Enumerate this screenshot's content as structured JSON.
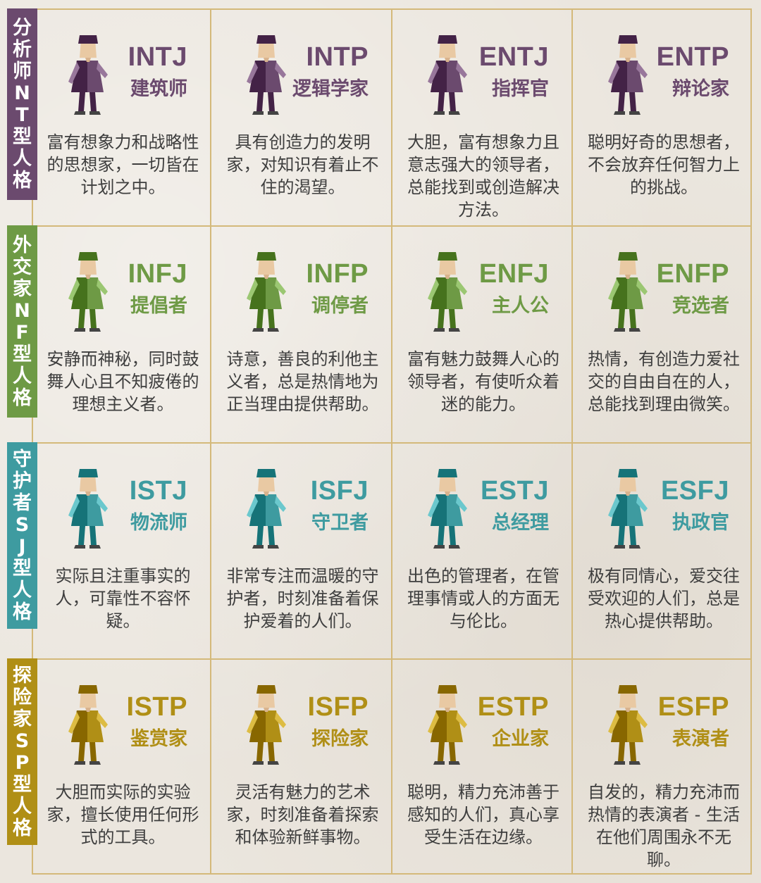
{
  "colors": {
    "NT": "#6b4a6e",
    "NF": "#6e9a45",
    "SJ": "#3e9ba0",
    "SP": "#b08f16",
    "grid_line": "#d4b97a"
  },
  "groups": [
    {
      "key": "NT",
      "label": [
        "分",
        "析",
        "师",
        "N",
        "T",
        "型",
        "人",
        "格"
      ],
      "types": [
        {
          "code": "INTJ",
          "name": "建筑师",
          "desc": "富有想象力和战略性的思想家，一切皆在计划之中。",
          "icon": "architect-figure-icon"
        },
        {
          "code": "INTP",
          "name": "逻辑学家",
          "desc": "具有创造力的发明家，对知识有着止不住的渴望。",
          "icon": "logician-figure-icon"
        },
        {
          "code": "ENTJ",
          "name": "指挥官",
          "desc": "大胆，富有想象力且意志强大的领导者，总能找到或创造解决方法。",
          "icon": "commander-figure-icon"
        },
        {
          "code": "ENTP",
          "name": "辩论家",
          "desc": "聪明好奇的思想者，不会放弃任何智力上的挑战。",
          "icon": "debater-figure-icon"
        }
      ]
    },
    {
      "key": "NF",
      "label": [
        "外",
        "交",
        "家",
        "N",
        "F",
        "型",
        "人",
        "格"
      ],
      "types": [
        {
          "code": "INFJ",
          "name": "提倡者",
          "desc": "安静而神秘，同时鼓舞人心且不知疲倦的理想主义者。",
          "icon": "advocate-figure-icon"
        },
        {
          "code": "INFP",
          "name": "调停者",
          "desc": "诗意，善良的利他主义者，总是热情地为正当理由提供帮助。",
          "icon": "mediator-figure-icon"
        },
        {
          "code": "ENFJ",
          "name": "主人公",
          "desc": "富有魅力鼓舞人心的领导者，有使听众着迷的能力。",
          "icon": "protagonist-figure-icon"
        },
        {
          "code": "ENFP",
          "name": "竞选者",
          "desc": "热情，有创造力爱社交的自由自在的人，总能找到理由微笑。",
          "icon": "campaigner-figure-icon"
        }
      ]
    },
    {
      "key": "SJ",
      "label": [
        "守",
        "护",
        "者",
        "S",
        "J",
        "型",
        "人",
        "格"
      ],
      "types": [
        {
          "code": "ISTJ",
          "name": "物流师",
          "desc": "实际且注重事实的人，可靠性不容怀疑。",
          "icon": "logistician-figure-icon"
        },
        {
          "code": "ISFJ",
          "name": "守卫者",
          "desc": "非常专注而温暖的守护者，时刻准备着保护爱着的人们。",
          "icon": "defender-figure-icon"
        },
        {
          "code": "ESTJ",
          "name": "总经理",
          "desc": "出色的管理者，在管理事情或人的方面无与伦比。",
          "icon": "executive-figure-icon"
        },
        {
          "code": "ESFJ",
          "name": "执政官",
          "desc": "极有同情心，爱交往受欢迎的人们，总是热心提供帮助。",
          "icon": "consul-figure-icon"
        }
      ]
    },
    {
      "key": "SP",
      "label": [
        "探",
        "险",
        "家",
        "S",
        "P",
        "型",
        "人",
        "格"
      ],
      "types": [
        {
          "code": "ISTP",
          "name": "鉴赏家",
          "desc": "大胆而实际的实验家，擅长使用任何形式的工具。",
          "icon": "virtuoso-figure-icon"
        },
        {
          "code": "ISFP",
          "name": "探险家",
          "desc": "灵活有魅力的艺术家，时刻准备着探索和体验新鲜事物。",
          "icon": "adventurer-figure-icon"
        },
        {
          "code": "ESTP",
          "name": "企业家",
          "desc": "聪明，精力充沛善于感知的人们，真心享受生活在边缘。",
          "icon": "entrepreneur-figure-icon"
        },
        {
          "code": "ESFP",
          "name": "表演者",
          "desc": "自发的，精力充沛而热情的表演者 - 生活在他们周围永不无聊。",
          "icon": "entertainer-figure-icon"
        }
      ]
    }
  ]
}
